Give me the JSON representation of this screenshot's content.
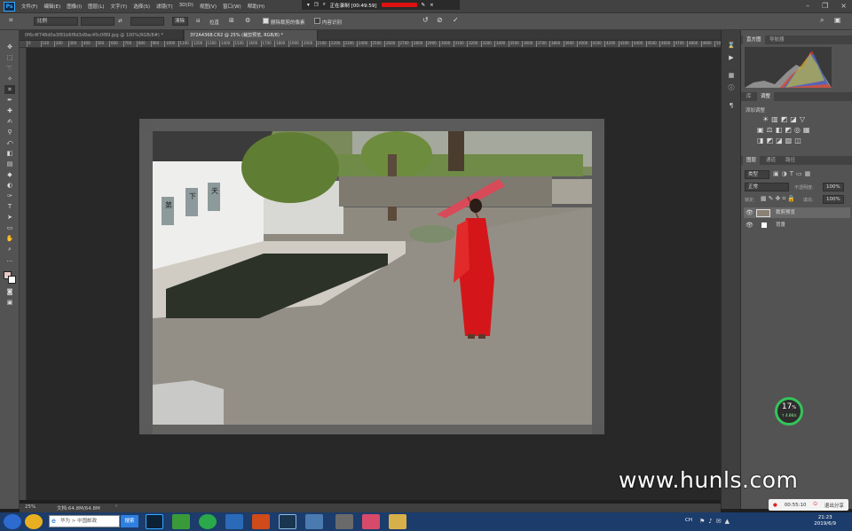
{
  "menubar": {
    "logo": "Ps",
    "items": [
      "文件(F)",
      "编辑(E)",
      "图像(I)",
      "图层(L)",
      "文字(Y)",
      "选择(S)",
      "滤镜(T)",
      "3D(D)",
      "视图(V)",
      "窗口(W)",
      "帮助(H)"
    ],
    "recording_label": "正在录制 [00:49:59]"
  },
  "options": {
    "ratio": "比例",
    "clear": "清除",
    "straighten": "拉直",
    "delete_cropped": "删除裁剪的像素",
    "content_aware": "内容识别"
  },
  "tabs": [
    {
      "label": "0f6c4f748d0a3f81b6f8d3d9ac45c0f89.jpg @ 100%(RGB/8#) *"
    },
    {
      "label": "3Y2A4368.CR2 @ 25% (裁剪预览, RGB/8) *"
    }
  ],
  "ruler_ticks": [
    "0",
    "100",
    "200",
    "300",
    "400",
    "500",
    "600",
    "700",
    "800",
    "900",
    "1000",
    "1100",
    "1200",
    "1300",
    "1400",
    "1500",
    "1600",
    "1700",
    "1800",
    "1900",
    "2000",
    "2100",
    "2200",
    "2300",
    "2400",
    "2500",
    "2600",
    "2700",
    "2800",
    "2900",
    "3000",
    "3100",
    "3200",
    "3300",
    "3400",
    "3500",
    "3600",
    "3700",
    "3800",
    "3900",
    "4000",
    "4100",
    "4200",
    "4300",
    "4400",
    "4500",
    "4600",
    "4700",
    "4800",
    "4900",
    "5000"
  ],
  "status": {
    "zoom": "25%",
    "doc": "文档:64.8M/64.8M"
  },
  "photo": {
    "sign": [
      "苐",
      "下",
      "天"
    ]
  },
  "panels": {
    "histogram_tabs": [
      "直方图",
      "导航器"
    ],
    "adjust_tabs": [
      "库",
      "调整"
    ],
    "adjust_title": "添加调整",
    "layers_tabs": [
      "图层",
      "通道",
      "路径"
    ],
    "kind_placeholder": "类型",
    "blend_mode": "正常",
    "opacity_label": "不透明度:",
    "opacity_value": "100%",
    "lock_label": "锁定:",
    "fill_label": "填充:",
    "fill_value": "100%",
    "layers": [
      {
        "name": "裁剪预览"
      },
      {
        "name": "背景"
      }
    ]
  },
  "overlay": {
    "percent": "17",
    "percent_unit": "%",
    "speed": "↑ 4.6K/s",
    "timer": "00:55:10",
    "exit_share": "退出分享",
    "watermark": "www.hunls.com"
  },
  "taskbar": {
    "search_placeholder": "华为 > 中国邮政",
    "search_btn": "搜索",
    "ime": "CH",
    "time": "21:23",
    "date": "2019/6/9"
  }
}
